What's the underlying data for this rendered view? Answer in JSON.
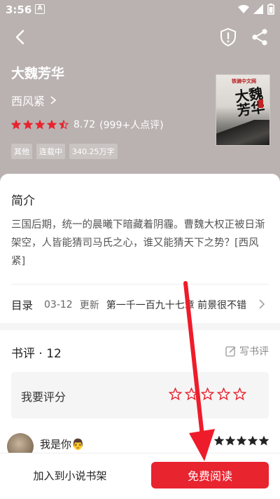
{
  "status_bar": {
    "time": "3:56",
    "badge": "A"
  },
  "book": {
    "title": "大魏芳华",
    "author": "西风紧",
    "rating": "8.72",
    "rating_count": "(999+人点评)",
    "rating_stars": 4.5,
    "tags": [
      "其他",
      "连载中",
      "340.25万字"
    ],
    "cover": {
      "publisher": "铁骑中文网",
      "title": "大魏芳华"
    }
  },
  "intro": {
    "heading": "简介",
    "text": "三国后期，统一的晨曦下暗藏着阴霾。曹魏大权正被日渐架空，人皆能猜司马氏之心，谁又能猜天下之势？[西风紧]"
  },
  "toc": {
    "label": "目录",
    "date": "03-12",
    "update": "更新",
    "chapter": "第一千一百九十七章 前景很不错"
  },
  "reviews": {
    "heading": "书评 · 12",
    "write_label": "写书评",
    "rate_label": "我要评分",
    "comment": {
      "username": "我是你👨",
      "stars": 5
    }
  },
  "bottom": {
    "add_shelf": "加入到小说书架",
    "read_free": "免费阅读"
  },
  "colors": {
    "accent": "#e8242f",
    "hero": "#bab2b1"
  },
  "icons": [
    "back-icon",
    "shield-icon",
    "share-icon",
    "chevron-right-icon",
    "edit-icon",
    "star-icon"
  ]
}
